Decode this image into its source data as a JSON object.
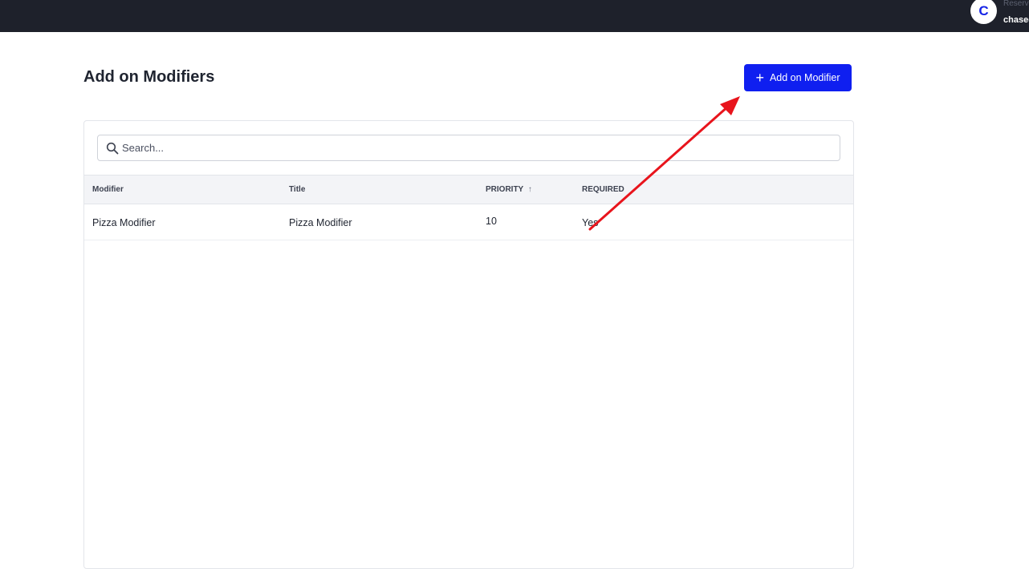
{
  "topbar": {
    "avatar_initial": "C",
    "user_role": "Reserv",
    "user_email": "chase("
  },
  "page": {
    "title": "Add on Modifiers",
    "add_button_label": "Add on Modifier"
  },
  "search": {
    "placeholder": "Search...",
    "value": ""
  },
  "table": {
    "columns": [
      "Modifier",
      "Title",
      "PRIORITY",
      "REQUIRED"
    ],
    "sort_indicator": "↑",
    "rows": [
      {
        "modifier": "Pizza Modifier",
        "title": "Pizza Modifier",
        "priority": "10",
        "required": "Yes"
      }
    ]
  },
  "colors": {
    "topbar": "#1e212b",
    "primary": "#0f1ff0",
    "annotation_arrow": "#e8141c"
  },
  "icons": {
    "search": "search-icon",
    "add": "plus-icon",
    "sort": "sort-ascending-icon"
  }
}
